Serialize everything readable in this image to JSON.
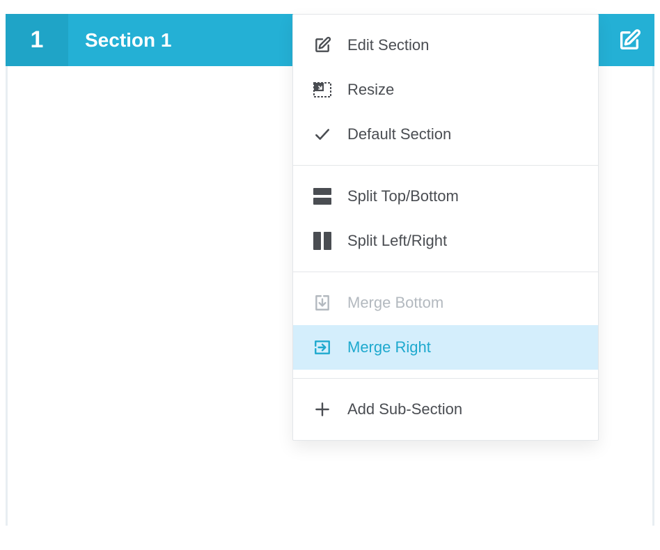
{
  "section": {
    "number": "1",
    "title": "Section 1"
  },
  "menu": {
    "group1": {
      "edit": "Edit Section",
      "resize": "Resize",
      "default": "Default Section"
    },
    "group2": {
      "split_tb": "Split Top/Bottom",
      "split_lr": "Split Left/Right"
    },
    "group3": {
      "merge_bottom": "Merge Bottom",
      "merge_right": "Merge Right"
    },
    "group4": {
      "add_sub": "Add Sub-Section"
    }
  },
  "colors": {
    "bar": "#24b0d5",
    "bar_dark": "#1fa4c7",
    "highlight_bg": "#d4eefc",
    "highlight_fg": "#1ea9ce",
    "text": "#4a4d52",
    "disabled": "#b3b9bf",
    "border": "#e3e6e9"
  }
}
